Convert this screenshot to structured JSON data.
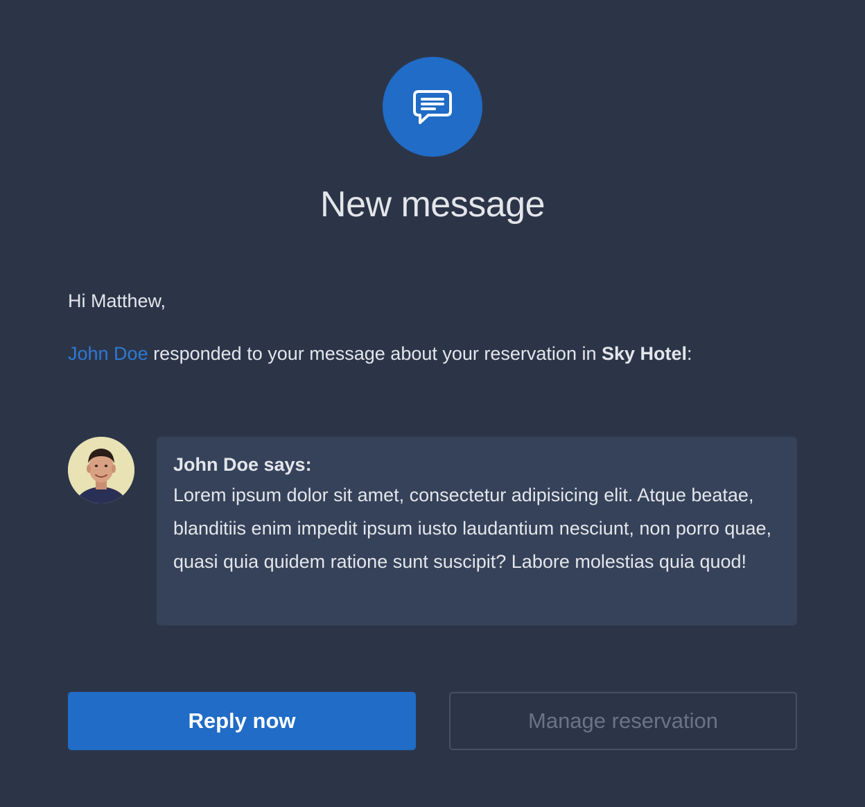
{
  "header": {
    "icon": "message-icon",
    "title": "New message"
  },
  "body": {
    "greeting": "Hi Matthew,",
    "sender_name": "John Doe",
    "intro_text": " responded to your message about your reservation in ",
    "hotel_name": "Sky Hotel",
    "intro_end": ":"
  },
  "message": {
    "avatar": "avatar-john-doe",
    "heading": "John Doe says:",
    "text": "Lorem ipsum dolor sit amet, consectetur adipisicing elit. Atque beatae, blanditiis enim impedit ipsum iusto laudantium nesciunt, non porro quae, quasi quia quidem ratione sunt suscipit? Labore molestias quia quod!"
  },
  "actions": {
    "reply_label": "Reply now",
    "manage_label": "Manage reservation"
  },
  "colors": {
    "background": "#2c3548",
    "accent": "#206cc6",
    "link": "#2f78d3",
    "bubble": "#364259"
  }
}
